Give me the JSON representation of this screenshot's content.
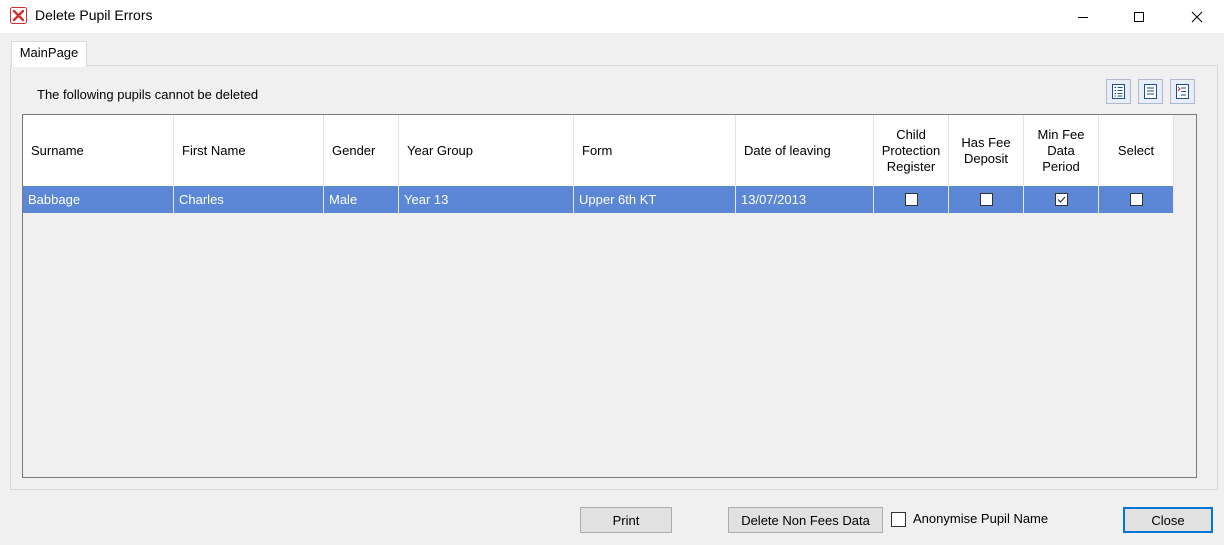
{
  "window": {
    "title": "Delete Pupil Errors",
    "controls": [
      "minimize",
      "maximize",
      "close"
    ]
  },
  "tabs": [
    {
      "label": "MainPage",
      "active": true
    }
  ],
  "panel": {
    "label": "The following pupils cannot be deleted",
    "toolbar_icons": [
      "list-details-icon",
      "list-icon",
      "list-select-icon"
    ]
  },
  "grid": {
    "columns": [
      {
        "label": "Surname"
      },
      {
        "label": "First Name"
      },
      {
        "label": "Gender"
      },
      {
        "label": "Year Group"
      },
      {
        "label": "Form"
      },
      {
        "label": "Date of leaving"
      },
      {
        "label": "Child Protection Register"
      },
      {
        "label": "Has Fee Deposit"
      },
      {
        "label": "Min Fee Data Period"
      },
      {
        "label": "Select"
      }
    ],
    "rows": [
      {
        "surname": "Babbage",
        "first_name": "Charles",
        "gender": "Male",
        "year_group": "Year 13",
        "form": "Upper 6th KT",
        "date_of_leaving": "13/07/2013",
        "child_protection_register": false,
        "has_fee_deposit": false,
        "min_fee_data_period": true,
        "select": false,
        "selected": true
      }
    ]
  },
  "footer": {
    "print_label": "Print",
    "delete_non_fees_label": "Delete Non Fees Data",
    "anonymise_label": "Anonymise Pupil Name",
    "anonymise_checked": false,
    "close_label": "Close"
  },
  "colors": {
    "selection": "#5b87d6",
    "default_button_border": "#0078d7",
    "app_icon_red": "#d32f2f"
  }
}
